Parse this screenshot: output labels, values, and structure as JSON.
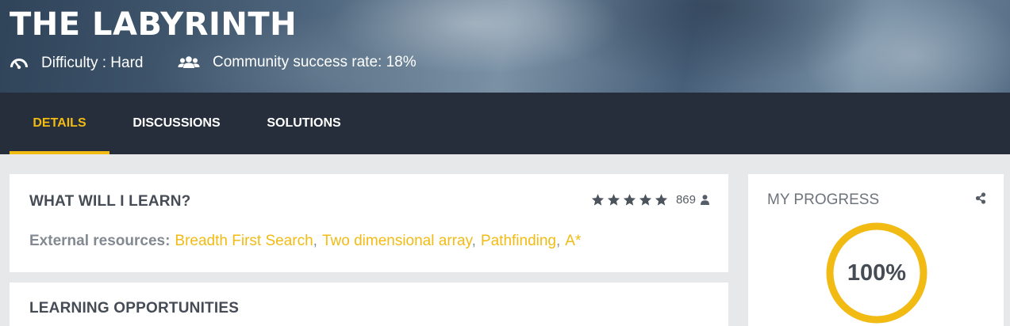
{
  "hero": {
    "title": "THE LABYRINTH",
    "difficulty": "Difficulty : Hard",
    "success_rate": "Community success rate: 18%",
    "difficulty_icon": "speedometer-icon",
    "community_icon": "users-icon"
  },
  "nav": {
    "tabs": [
      {
        "label": "DETAILS",
        "active": true
      },
      {
        "label": "DISCUSSIONS",
        "active": false
      },
      {
        "label": "SOLUTIONS",
        "active": false
      }
    ]
  },
  "learn": {
    "title": "WHAT WILL I LEARN?",
    "rating_stars": 5,
    "rating_count": "869",
    "resources_label": "External resources:",
    "resources": [
      "Breadth First Search",
      "Two dimensional array",
      "Pathfinding",
      "A*"
    ]
  },
  "opportunities": {
    "title": "LEARNING OPPORTUNITIES"
  },
  "progress": {
    "title": "MY PROGRESS",
    "value_text": "100%",
    "value": 1.0
  },
  "colors": {
    "accent": "#f2bb13",
    "nav_bg": "#252e3a",
    "page_bg": "#e7e8ea",
    "heading": "#454c55"
  }
}
